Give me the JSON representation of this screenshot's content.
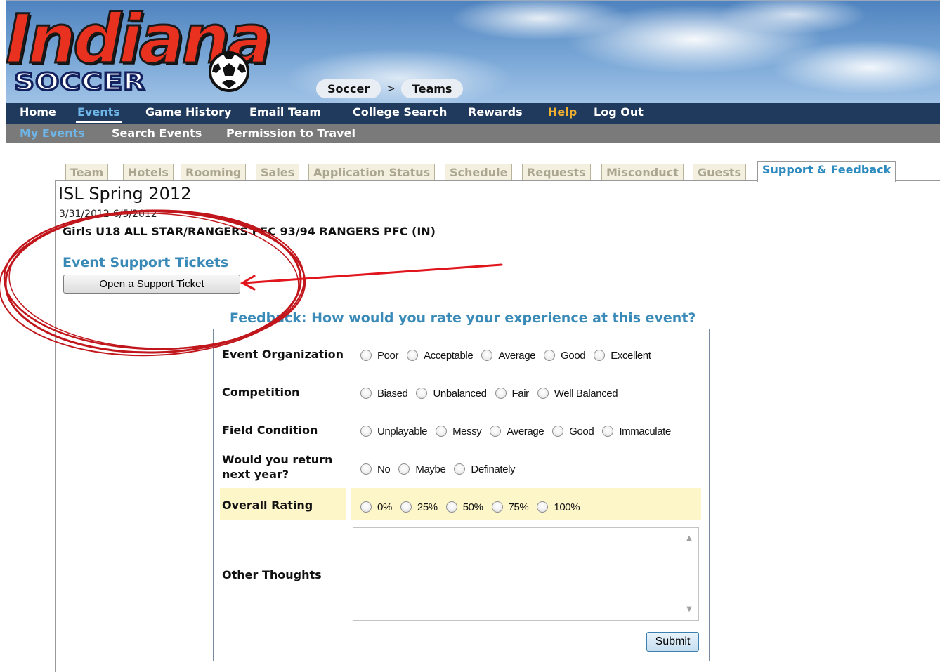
{
  "logo": {
    "word": "Indiana",
    "sub": "SOCCER"
  },
  "breadcrumb": {
    "items": [
      "Soccer",
      "Teams"
    ],
    "separator": ">"
  },
  "nav_primary": {
    "items": [
      "Home",
      "Events",
      "Game History",
      "Email Team",
      "College Search",
      "Rewards",
      "Help",
      "Log Out"
    ],
    "active": "Events"
  },
  "nav_secondary": {
    "items": [
      "My Events",
      "Search Events",
      "Permission to Travel"
    ],
    "active": "My Events"
  },
  "tabs": {
    "items": [
      "Team",
      "Hotels",
      "Rooming",
      "Sales",
      "Application Status",
      "Schedule",
      "Requests",
      "Misconduct",
      "Guests",
      "Support & Feedback"
    ],
    "active": "Support & Feedback"
  },
  "event": {
    "title": "ISL Spring 2012",
    "dates": "3/31/2012-6/5/2012",
    "team": "Girls U18 ALL STAR/RANGERS PFC 93/94 RANGERS PFC (IN)"
  },
  "support": {
    "heading": "Event Support Tickets",
    "button_label": "Open a Support Ticket"
  },
  "feedback": {
    "title": "Feedback: How would you rate your experience at this event?",
    "questions": [
      {
        "label": "Event Organization",
        "options": [
          "Poor",
          "Acceptable",
          "Average",
          "Good",
          "Excellent"
        ]
      },
      {
        "label": "Competition",
        "options": [
          "Biased",
          "Unbalanced",
          "Fair",
          "Well Balanced"
        ]
      },
      {
        "label": "Field Condition",
        "options": [
          "Unplayable",
          "Messy",
          "Average",
          "Good",
          "Immaculate"
        ]
      },
      {
        "label": "Would you return next year?",
        "options": [
          "No",
          "Maybe",
          "Definately"
        ]
      },
      {
        "label": "Overall Rating",
        "options": [
          "0%",
          "25%",
          "50%",
          "75%",
          "100%"
        ]
      }
    ],
    "other_label": "Other Thoughts",
    "other_value": "",
    "submit_label": "Submit"
  },
  "colors": {
    "nav_primary_bg": "#1f3a5c",
    "nav_secondary_bg": "#7a7a7a",
    "accent": "#3a8ab8",
    "help": "#f0b030",
    "highlight": "#fdf6c9",
    "annotation": "#c0161c"
  }
}
